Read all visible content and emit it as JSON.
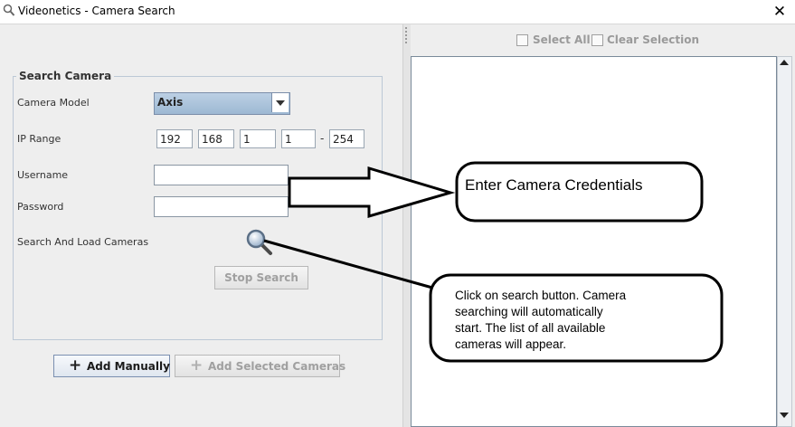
{
  "window": {
    "title": "Videonetics - Camera Search",
    "close_glyph": "✕"
  },
  "search_panel": {
    "legend": "Search Camera",
    "camera_model": {
      "label": "Camera Model",
      "value": "Axis"
    },
    "ip_range": {
      "label": "IP Range",
      "oct1": "192",
      "oct2": "168",
      "oct3": "1",
      "oct4_start": "1",
      "separator": "-",
      "oct4_end": "254"
    },
    "username": {
      "label": "Username",
      "value": ""
    },
    "password": {
      "label": "Password",
      "value": ""
    },
    "search_load": {
      "label": "Search And Load Cameras",
      "icon": "search-icon"
    },
    "stop_search_label": "Stop Search"
  },
  "bottom_buttons": {
    "add_manually": {
      "label": "Add Manually",
      "icon": "plus-icon"
    },
    "add_selected": {
      "label": "Add Selected Cameras",
      "icon": "plus-icon"
    }
  },
  "results_panel": {
    "select_all_label": "Select All",
    "clear_selection_label": "Clear Selection"
  },
  "annotations": {
    "credentials_note": "Enter Camera Credentials",
    "search_note_lines": [
      "Click on search button. Camera",
      "searching will automatically",
      "start. The list of all available",
      "cameras will appear."
    ]
  }
}
